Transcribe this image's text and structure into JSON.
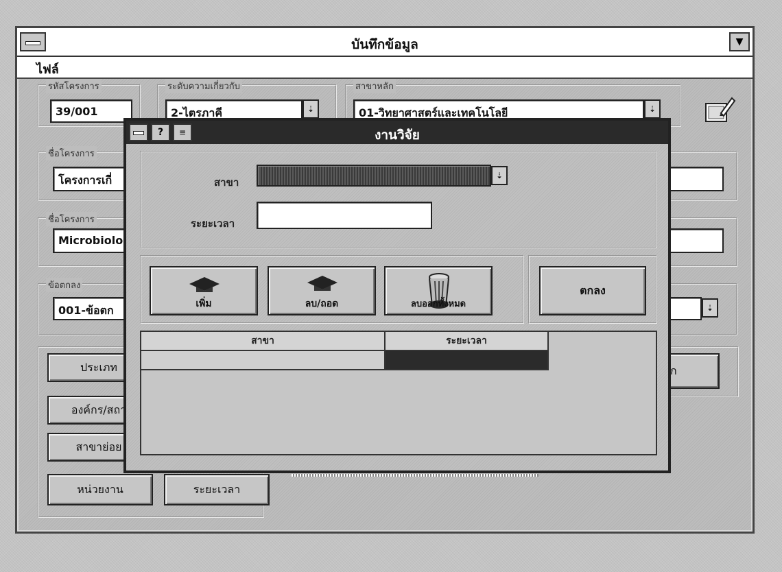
{
  "main_window": {
    "title": "บันทึกข้อมูล",
    "menu": [
      "ไฟล์"
    ],
    "project_code": {
      "legend": "รหัสโครงการ",
      "value": "39/001"
    },
    "research_level": {
      "legend": "ระดับความเกี่ยวกับ",
      "value": "2-ไตรภาคี"
    },
    "main_branch": {
      "legend": "สาขาหลัก",
      "value": "01-วิทยาศาสตร์และเทคโนโลยี"
    },
    "project_name_th": {
      "legend": "ชื่อโครงการ",
      "value": "โครงการเกี่"
    },
    "project_name_en": {
      "legend": "ชื่อโครงการ",
      "value": "Microbiolo"
    },
    "agreement": {
      "legend": "ข้อตกลง",
      "value": "001-ข้อตก"
    },
    "bottom_buttons": [
      "ประเภท",
      "องค์กร/สถา",
      "สาขาย่อย",
      "หน่วยงาน",
      "ระยะเวลา",
      "ก"
    ]
  },
  "dialog": {
    "title": "งานวิจัย",
    "branch_label": "สาขา",
    "branch_value": "",
    "duration_label": "ระยะเวลา",
    "duration_value": "",
    "buttons": {
      "add": "เพิ่ม",
      "delete": "ลบ/ถอด",
      "clear": "ลบออกทั้งหมด",
      "ok": "ตกลง"
    },
    "grid": {
      "columns": [
        "สาขา",
        "ระยะเวลา"
      ],
      "rows": [
        [
          "",
          ""
        ]
      ]
    }
  },
  "icons": {
    "system_menu": "system-menu-icon",
    "dropdown": "dropdown-arrow-icon",
    "tool": "edit-tool-icon",
    "add": "mortarboard-icon",
    "delete": "mortarboard-icon",
    "clear": "trash-can-icon"
  }
}
